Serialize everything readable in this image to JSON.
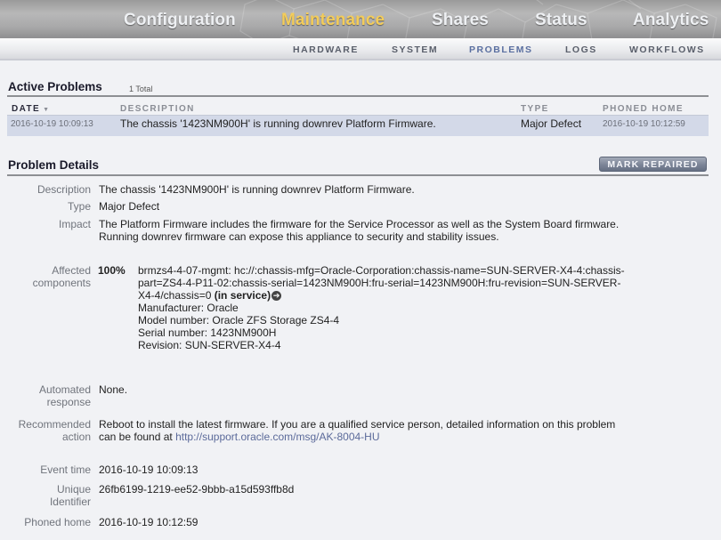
{
  "nav": {
    "tabs": [
      {
        "label": "Configuration",
        "active": false
      },
      {
        "label": "Maintenance",
        "active": true
      },
      {
        "label": "Shares",
        "active": false
      },
      {
        "label": "Status",
        "active": false
      },
      {
        "label": "Analytics",
        "active": false
      }
    ],
    "subtabs": [
      {
        "label": "HARDWARE",
        "active": false
      },
      {
        "label": "SYSTEM",
        "active": false
      },
      {
        "label": "PROBLEMS",
        "active": true
      },
      {
        "label": "LOGS",
        "active": false
      },
      {
        "label": "WORKFLOWS",
        "active": false
      }
    ],
    "active_color": "#f3cc5a"
  },
  "active_problems": {
    "title": "Active Problems",
    "count": "1 Total",
    "columns": {
      "date": "DATE",
      "sort_icon": "▼",
      "description": "DESCRIPTION",
      "type": "TYPE",
      "phoned_home": "PHONED HOME"
    },
    "rows": [
      {
        "date": "2016-10-19 10:09:13",
        "description": "The chassis '1423NM900H' is running downrev Platform Firmware.",
        "type": "Major Defect",
        "phoned_home": "2016-10-19 10:12:59"
      }
    ]
  },
  "details": {
    "title": "Problem Details",
    "mark_repaired": "MARK REPAIRED",
    "description_label": "Description",
    "description": "The chassis '1423NM900H' is running downrev Platform Firmware.",
    "type_label": "Type",
    "type": "Major Defect",
    "impact_label": "Impact",
    "impact_line1": "The Platform Firmware includes the firmware for the Service Processor as well as the System Board firmware.",
    "impact_line2": "Running downrev firmware can expose this appliance to security and stability issues.",
    "affected_label1": "Affected",
    "affected_label2": "components",
    "affected_pct": "100%",
    "affected_line1": "brmzs4-4-07-mgmt: hc://:chassis-mfg=Oracle-Corporation:chassis-name=SUN-SERVER-X4-4:chassis-",
    "affected_line2": "part=ZS4-4-P11-02:chassis-serial=1423NM900H:fru-serial=1423NM900H:fru-revision=SUN-SERVER-",
    "affected_line3": "X4-4/chassis=0 ",
    "affected_status": "(in service)",
    "manufacturer": "Manufacturer: Oracle",
    "model": "Model number: Oracle ZFS Storage ZS4-4",
    "serial": "Serial number: 1423NM900H",
    "revision": "Revision: SUN-SERVER-X4-4",
    "automated_label1": "Automated",
    "automated_label2": "response",
    "automated": "None.",
    "recommended_label1": "Recommended",
    "recommended_label2": "action",
    "recommended_line1": "Reboot to install the latest firmware. If you are a qualified service person, detailed information on this problem",
    "recommended_line2_prefix": "can be found at ",
    "recommended_link": "http://support.oracle.com/msg/AK-8004-HU",
    "event_time_label": "Event time",
    "event_time": "2016-10-19 10:09:13",
    "uid_label1": "Unique",
    "uid_label2": "Identifier",
    "uid": "26fb6199-1219-ee52-9bbb-a15d593ffb8d",
    "phoned_label": "Phoned home",
    "phoned": "2016-10-19 10:12:59"
  }
}
